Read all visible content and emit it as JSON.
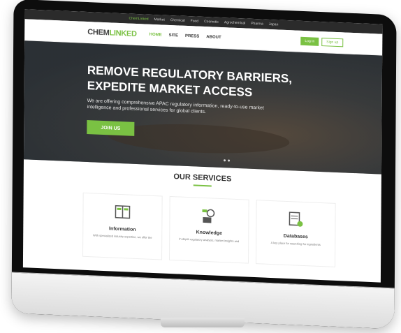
{
  "topbar": {
    "items": [
      "ChemLinked",
      "Market",
      "Chemical",
      "Food",
      "Cosmetic",
      "Agrochemical",
      "Pharma",
      "Japan"
    ]
  },
  "nav": {
    "logo_main": "CHEM",
    "logo_accent": "LINKED",
    "items": [
      "HOME",
      "SITE",
      "PRESS",
      "ABOUT"
    ],
    "login": "Log In",
    "signup": "Sign up"
  },
  "hero": {
    "title_line1": "REMOVE REGULATORY BARRIERS,",
    "title_line2": "EXPEDITE MARKET ACCESS",
    "subtitle": "We are offering comprehensive APAC regulatory information, ready-to-use market intelligence and professional services for global clients.",
    "cta": "JOIN US"
  },
  "services": {
    "title": "OUR SERVICES",
    "cards": [
      {
        "title": "Information",
        "desc": "With specialized industry expertise, we offer the"
      },
      {
        "title": "Knowledge",
        "desc": "In-depth regulatory analysis, market insights and"
      },
      {
        "title": "Databases",
        "desc": "A key place for searching for ingredients"
      }
    ]
  },
  "colors": {
    "accent": "#7ac143",
    "dark": "#2b2b2b"
  }
}
